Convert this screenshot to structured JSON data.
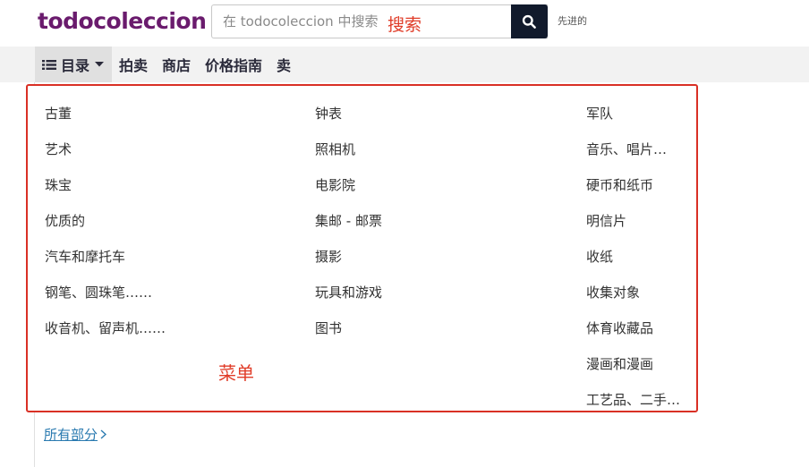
{
  "header": {
    "logo": "todocoleccion",
    "search_placeholder": "在 todocoleccion 中搜索",
    "search_annotation": "搜索",
    "advanced_link": "先进的"
  },
  "nav": {
    "catalog": "目录",
    "items": [
      "拍卖",
      "商店",
      "价格指南",
      "卖"
    ]
  },
  "menu": {
    "annotation": "菜单",
    "columns": [
      [
        "古董",
        "艺术",
        "珠宝",
        "优质的",
        "汽车和摩托车",
        "钢笔、圆珠笔……",
        "收音机、留声机……"
      ],
      [
        "钟表",
        "照相机",
        "电影院",
        "集邮 - 邮票",
        "摄影",
        "玩具和游戏",
        "图书"
      ],
      [
        "军队",
        "音乐、唱片…",
        "硬币和纸币",
        "明信片",
        "收纸",
        "收集对象",
        "体育收藏品",
        "漫画和漫画",
        "工艺品、二手…"
      ]
    ],
    "all_sections": "所有部分"
  },
  "colors": {
    "logo": "#6a1b6d",
    "search_button": "#111a2c",
    "annotation_red": "#e03c28",
    "menu_border": "#d93025",
    "link": "#2a7ab0"
  }
}
